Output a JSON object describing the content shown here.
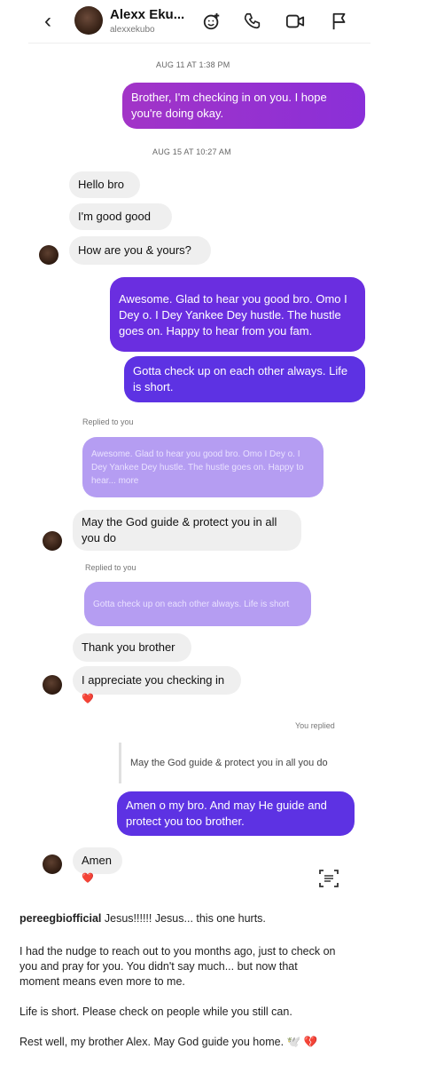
{
  "header": {
    "name": "Alexx Eku...",
    "username": "alexxekubo",
    "back_icon": "chevron-left-icon",
    "icons": [
      "emoji-plus-icon",
      "phone-icon",
      "video-icon",
      "flag-icon"
    ]
  },
  "messages": {
    "ts1": "AUG 11 AT 1:38 PM",
    "m1": "Brother, I'm checking in on you.  I hope you're doing okay.",
    "ts2": "AUG 15 AT 10:27 AM",
    "m2": "Hello bro",
    "m3": "I'm good good",
    "m4": "How are you & yours?",
    "m5": "Awesome. Glad to hear you good bro. Omo I Dey o.  I Dey Yankee Dey hustle. The hustle goes on.   Happy to hear from you fam.",
    "m6": "Gotta check up on each other always. Life is short.",
    "replied1": "Replied to you",
    "q1": "Awesome. Glad to hear you good bro.  Omo I Dey o.  I Dey Yankee Dey hustle.  The hustle goes on.  Happy to hear... more",
    "m7": "May the God guide & protect you in all you do",
    "replied2": "Replied to you",
    "q2": "Gotta check up on each other always.  Life is short",
    "m8": "Thank you brother",
    "m9": "I appreciate you checking in",
    "heart1": "❤️",
    "you_replied": "You replied",
    "q3": "May the God guide & protect you in all you do",
    "m10": "Amen o my bro.  And may He guide and protect you too brother.",
    "m11": "Amen",
    "heart2": "❤️"
  },
  "caption": {
    "user": "pereegbiofficial",
    "p1": "Jesus!!!!!! Jesus... this one hurts.",
    "p2a": "I had the nudge to reach out to you months ago, just to check on",
    "p2b": "you and pray for you. You didn't say much... but now that",
    "p2c": "moment means even more to me.",
    "p3": "Life is short. Please check on people while you still can.",
    "p4": "Rest well, my brother Alex. May God guide you home. 🕊️ 💔"
  },
  "colors": {
    "outgoing_gradient": [
      "#a234c7",
      "#8a2fd8"
    ],
    "outgoing": "#6a2ee0",
    "incoming": "#efefef",
    "quoted": "#b59df2"
  }
}
